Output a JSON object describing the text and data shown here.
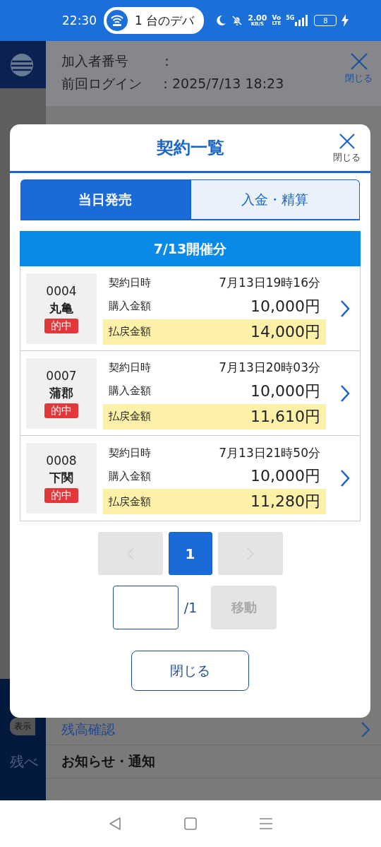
{
  "status_bar": {
    "time": "22:30",
    "notification": "1 台のデバ",
    "speed": "2.00",
    "speed_unit": "KB/S",
    "volte_top": "Vo",
    "volte_bottom": "LTE",
    "network": "5G",
    "battery": "8"
  },
  "background": {
    "member_label": "加入者番号",
    "member_separator": "：",
    "login_label": "前回ログイン",
    "login_value": "：2025/7/13 18:23",
    "close_label": "閉じる",
    "sidebar_button": "表示",
    "sidebar_text": "残べ",
    "menu_items": [
      {
        "label": "残高確認",
        "kind": "link"
      },
      {
        "label": "お知らせ・通知",
        "kind": "heading"
      }
    ]
  },
  "modal": {
    "title": "契約一覧",
    "close_label": "閉じる",
    "tabs": [
      {
        "label": "当日発売",
        "selected": true
      },
      {
        "label": "入金・精算",
        "selected": false
      }
    ],
    "section_title": "7/13開催分",
    "contracts": [
      {
        "number": "0004",
        "venue": "丸亀",
        "result": "的中",
        "fields": [
          {
            "label": "契約日時",
            "value": "7月13日19時16分",
            "kind": "date",
            "highlighted": false
          },
          {
            "label": "購入金額",
            "value": "10,000円",
            "kind": "amount",
            "highlighted": false
          },
          {
            "label": "払戻金額",
            "value": "14,000円",
            "kind": "amount",
            "highlighted": true
          }
        ]
      },
      {
        "number": "0007",
        "venue": "蒲郡",
        "result": "的中",
        "fields": [
          {
            "label": "契約日時",
            "value": "7月13日20時03分",
            "kind": "date",
            "highlighted": false
          },
          {
            "label": "購入金額",
            "value": "10,000円",
            "kind": "amount",
            "highlighted": false
          },
          {
            "label": "払戻金額",
            "value": "11,610円",
            "kind": "amount",
            "highlighted": true
          }
        ]
      },
      {
        "number": "0008",
        "venue": "下関",
        "result": "的中",
        "fields": [
          {
            "label": "契約日時",
            "value": "7月13日21時50分",
            "kind": "date",
            "highlighted": false
          },
          {
            "label": "購入金額",
            "value": "10,000円",
            "kind": "amount",
            "highlighted": false
          },
          {
            "label": "払戻金額",
            "value": "11,280円",
            "kind": "amount",
            "highlighted": true
          }
        ]
      }
    ],
    "pagination": {
      "prev_disabled": true,
      "next_disabled": true,
      "pages": [
        {
          "label": "1",
          "selected": true
        }
      ],
      "total": "/1",
      "go_button": {
        "label": "移動",
        "disabled": true
      }
    },
    "close_button": "閉じる"
  }
}
